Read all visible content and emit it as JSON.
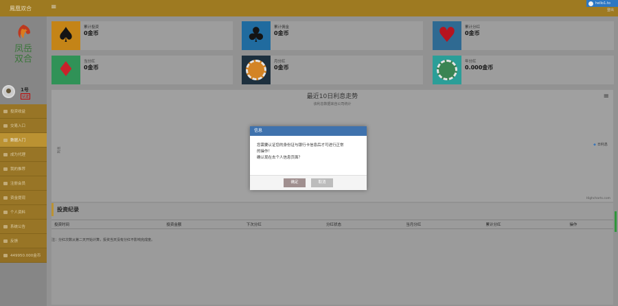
{
  "topbar": {
    "brand": "鳳凰双合",
    "menu_icon": "menu-icon",
    "badge": "hello1.to",
    "badge_sub": "登出"
  },
  "sidebar": {
    "logo_text": "凤凰双合",
    "user": {
      "name": "1号",
      "status": "认证"
    },
    "items": [
      {
        "label": "投资收益",
        "icon": "chart-icon"
      },
      {
        "label": "交易入口",
        "icon": "doc-icon"
      },
      {
        "label": "数据入门",
        "icon": "arrows-icon",
        "active": true
      },
      {
        "label": "成为代理",
        "icon": "flag-icon"
      },
      {
        "label": "我的推荐",
        "icon": "list-icon"
      },
      {
        "label": "注册会员",
        "icon": "user-icon"
      },
      {
        "label": "资金提现",
        "icon": "wallet-icon"
      },
      {
        "label": "个人资料",
        "icon": "person-icon"
      },
      {
        "label": "系统公告",
        "icon": "bell-icon"
      },
      {
        "label": "反馈",
        "icon": "mail-icon"
      },
      {
        "label": "449950.000金币",
        "icon": "dollar-icon",
        "balance": true
      }
    ]
  },
  "cards": [
    {
      "label": "累计投资",
      "value": "0金币",
      "icon": "spade",
      "bg": "#d08a14",
      "fg": "#111"
    },
    {
      "label": "累计佣金",
      "value": "0金币",
      "icon": "club",
      "bg": "#1e6fa8",
      "fg": "#111"
    },
    {
      "label": "累计分红",
      "value": "0金币",
      "icon": "heart",
      "bg": "#2e6e9a",
      "fg": "#c0111d"
    },
    {
      "label": "当分红",
      "value": "0金币",
      "icon": "diamond",
      "bg": "#2f9a5a",
      "fg": "#d5202a"
    },
    {
      "label": "月分红",
      "value": "0金币",
      "icon": "chip-orange",
      "bg": "#1b2f3e",
      "fg": "#e08a23"
    },
    {
      "label": "年分红",
      "value": "0.000金币",
      "icon": "chip-green",
      "bg": "#2aa6a0",
      "fg": "#3a8a55"
    }
  ],
  "chart": {
    "title": "最近10日利息走势",
    "subtitle": "该利息数据来自公司统计",
    "ylabel": "利息",
    "legend": "日利息",
    "credit": "Highcharts.com"
  },
  "records": {
    "title": "投资纪录",
    "columns": [
      "投资时间",
      "投资金额",
      "下次分红",
      "分红状态",
      "当月分红",
      "累计分红",
      "操作"
    ],
    "note": "注：分红次数从第二天开始计算，投资当天没有分红不影响完成度。"
  },
  "modal": {
    "title": "信息",
    "lines": [
      "您需要认证您的身份证与银行卡信息后才可进行正常",
      "的操作！",
      "确认现在去个人信息页面？"
    ],
    "ok": "确定",
    "cancel": "取消"
  }
}
